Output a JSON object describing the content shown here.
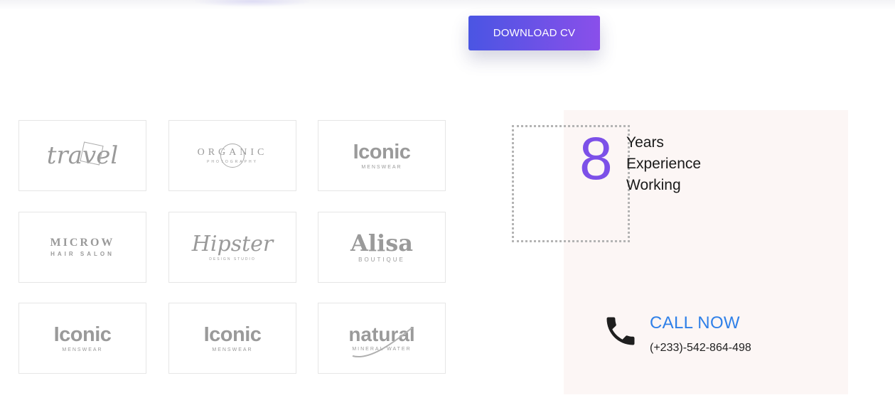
{
  "hero": {
    "download_label": "DOWNLOAD CV"
  },
  "clients": [
    {
      "name": "travel",
      "sub": ""
    },
    {
      "name": "ORGANIC",
      "sub": "PHOTOGRAPHY"
    },
    {
      "name": "Iconic",
      "sub": "MENSWEAR"
    },
    {
      "name": "MICROW",
      "sub": "HAIR SALON"
    },
    {
      "name": "Hipster",
      "sub": "DESIGN STUDIO"
    },
    {
      "name": "Alisa",
      "sub": "BOUTIQUE"
    },
    {
      "name": "Iconic",
      "sub": "MENSWEAR"
    },
    {
      "name": "Iconic",
      "sub": "MENSWEAR"
    },
    {
      "name": "natural",
      "sub": "MINERAL WATER"
    }
  ],
  "experience": {
    "number": "8",
    "line1": "Years",
    "line2": "Experience",
    "line3": "Working"
  },
  "contact": {
    "icon": "phone-icon",
    "cta": "CALL NOW",
    "phone": "(+233)-542-864-498"
  },
  "colors": {
    "accent_purple": "#7c50e8",
    "button_gradient_start": "#4a55e3",
    "button_gradient_end": "#8a4fea",
    "link_blue": "#2f80e8",
    "panel_bg": "#fcf6f5"
  }
}
